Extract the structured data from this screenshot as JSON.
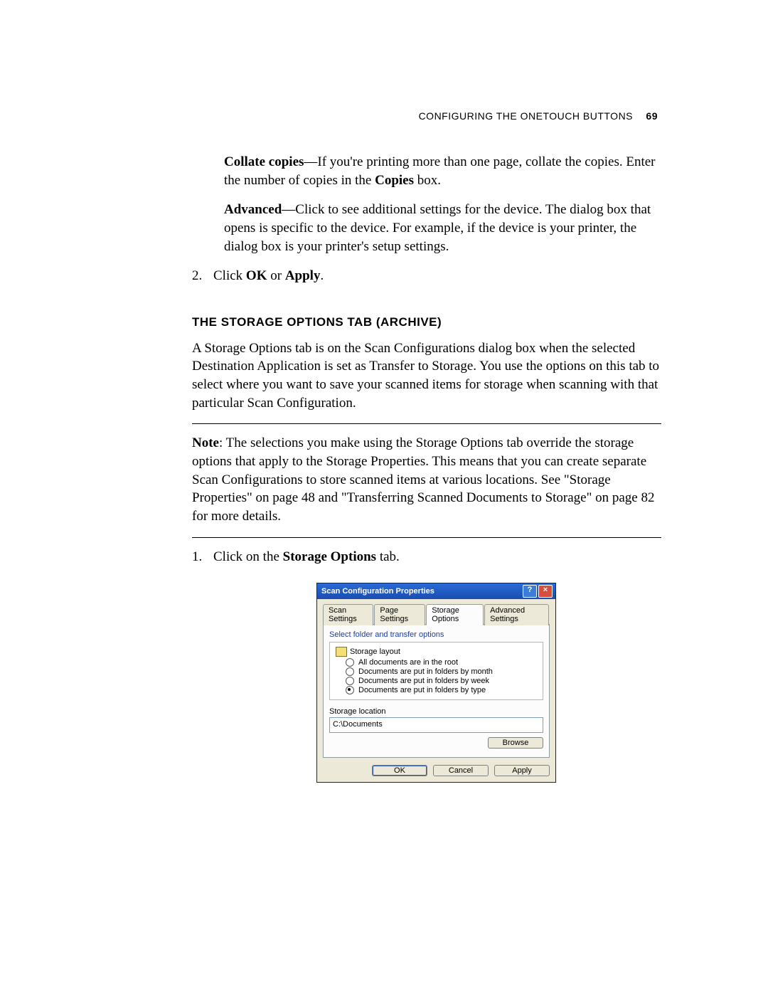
{
  "header": {
    "running": "CONFIGURING THE ONETOUCH BUTTONS",
    "page_number": "69"
  },
  "para_collate_lead": "Collate copies",
  "para_collate_rest": "—If you're printing more than one page, collate the copies. Enter the number of copies in the ",
  "para_collate_tail_bold": "Copies",
  "para_collate_tail": " box.",
  "para_adv_lead": "Advanced",
  "para_adv_rest": "—Click to see additional settings for the device. The dialog box that opens is specific to the device. For example, if the device is your printer, the dialog box is your printer's setup settings.",
  "step2_num": "2.",
  "step2_a": "Click ",
  "step2_b": "OK",
  "step2_c": " or ",
  "step2_d": "Apply",
  "step2_e": ".",
  "section_heading": "THE STORAGE OPTIONS TAB (ARCHIVE)",
  "para_storage": "A Storage Options tab is on the Scan Configurations dialog box when the selected Destination Application is set as Transfer to Storage. You use the options on this tab to select where you want to save your scanned items for storage when scanning with that particular Scan Configuration.",
  "note_lead": "Note",
  "note_rest": ":  The selections you make using the Storage Options tab override the storage options that apply to the Storage Properties. This means that you can create separate Scan Configurations to store scanned items at various locations. See \"Storage Properties\" on page 48 and \"Transferring Scanned Documents to Storage\" on page 82 for more details.",
  "step1_num": "1.",
  "step1_a": "Click on the ",
  "step1_b": "Storage Options",
  "step1_c": " tab.",
  "dialog": {
    "title": "Scan Configuration Properties",
    "tabs": [
      "Scan Settings",
      "Page Settings",
      "Storage Options",
      "Advanced Settings"
    ],
    "fieldset_label": "Select folder and transfer options",
    "layout_head": "Storage layout",
    "radios": [
      "All documents are in the root",
      "Documents are put in folders by month",
      "Documents are put in folders by week",
      "Documents are put in folders by type"
    ],
    "selected_radio": 3,
    "loc_label": "Storage location",
    "path": "C:\\Documents",
    "browse": "Browse",
    "ok": "OK",
    "cancel": "Cancel",
    "apply": "Apply"
  }
}
